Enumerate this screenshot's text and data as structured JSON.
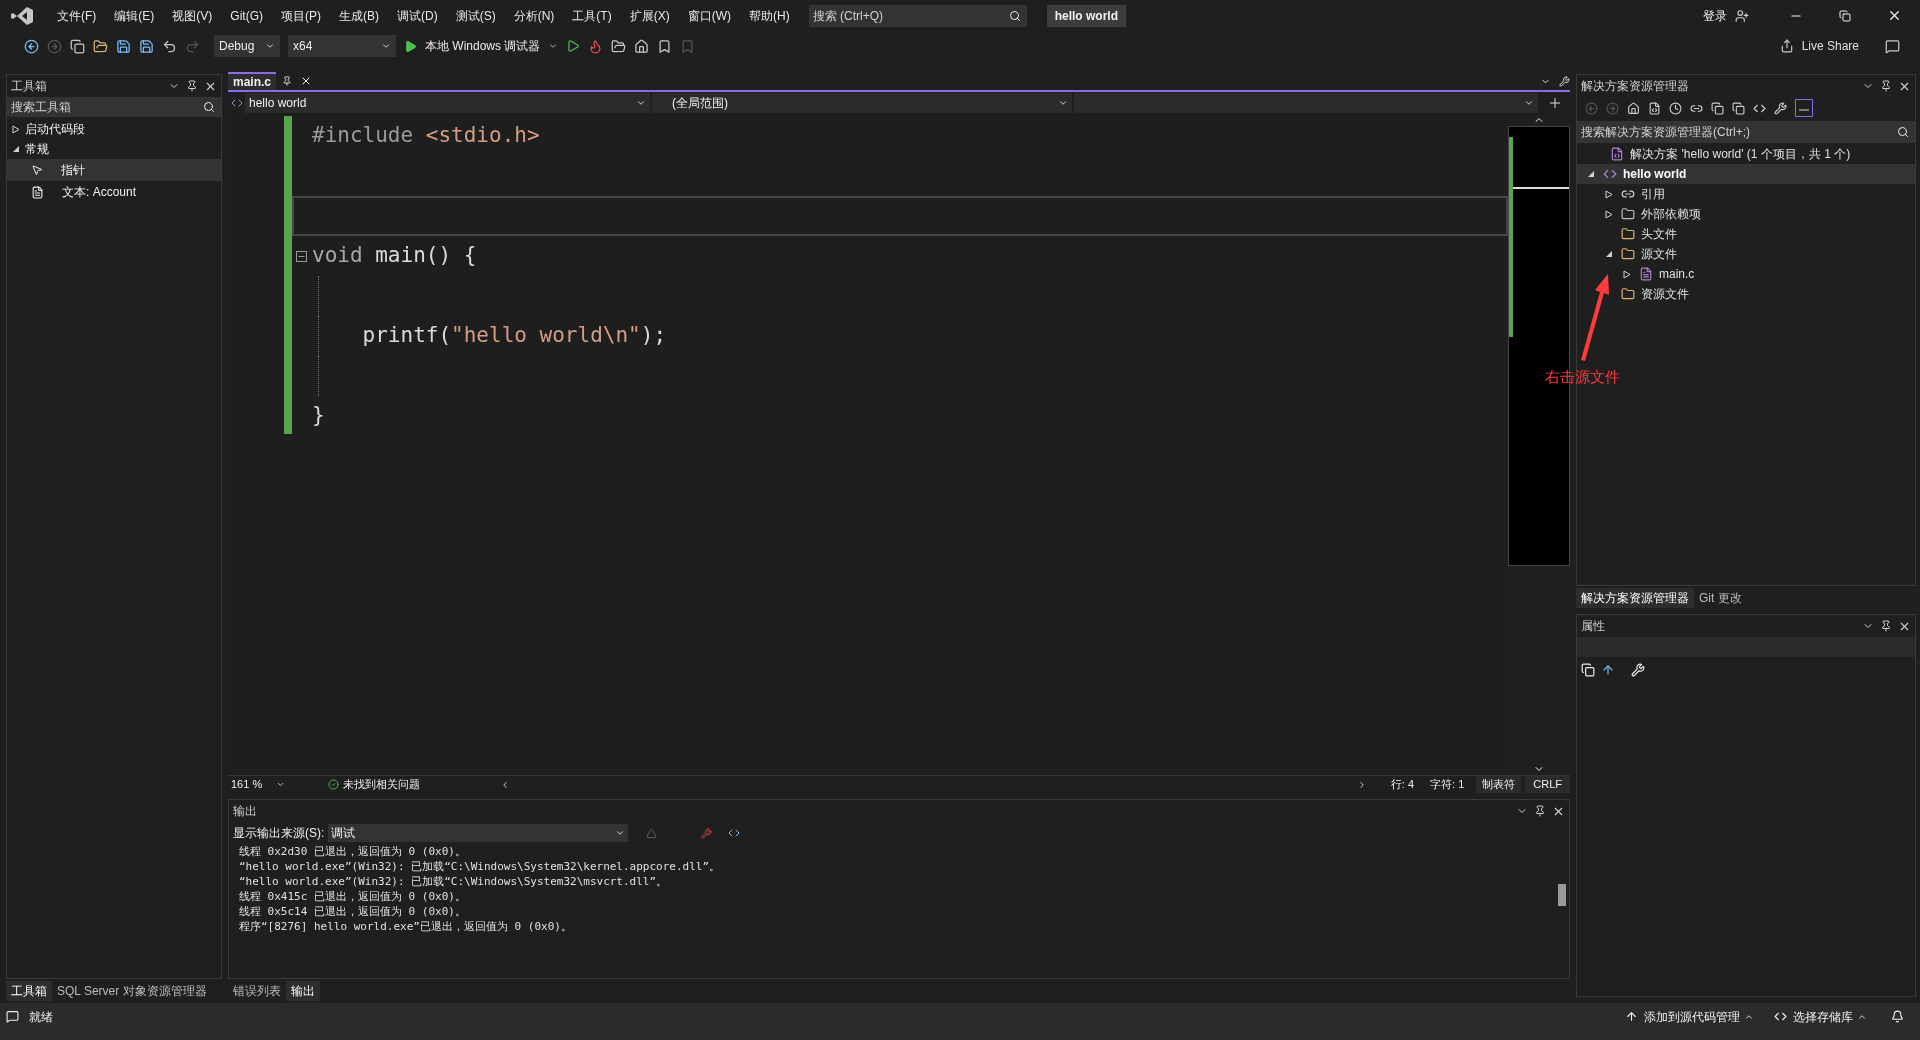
{
  "menu": [
    "文件(F)",
    "编辑(E)",
    "视图(V)",
    "Git(G)",
    "项目(P)",
    "生成(B)",
    "调试(D)",
    "测试(S)",
    "分析(N)",
    "工具(T)",
    "扩展(X)",
    "窗口(W)",
    "帮助(H)"
  ],
  "search": {
    "placeholder": "搜索 (Ctrl+Q)"
  },
  "solution_badge": "hello world",
  "account": "登录",
  "toolbar": {
    "configuration": "Debug",
    "platform": "x64",
    "run": "本地 Windows 调试器"
  },
  "live_share": "Live Share",
  "toolbox": {
    "title": "工具箱",
    "search_placeholder": "搜索工具箱",
    "groups": [
      {
        "label": "启动代码段",
        "expanded": false
      },
      {
        "label": "常规",
        "expanded": true,
        "children": [
          {
            "label": "指针",
            "kind": "pointer",
            "selected": true
          },
          {
            "label": "文本: Account",
            "kind": "text",
            "selected": false
          }
        ]
      }
    ]
  },
  "left_tabs": [
    {
      "label": "工具箱",
      "selected": true
    },
    {
      "label": "SQL Server 对象资源管理器",
      "selected": false
    }
  ],
  "editor": {
    "tabs": [
      {
        "label": "main.c",
        "selected": true
      }
    ],
    "nav": [
      "hello world",
      "(全局范围)"
    ],
    "lines": [
      {
        "current": false,
        "tokens": [
          {
            "text": "#include ",
            "kind": "preproc"
          },
          {
            "text": "<stdio.h>",
            "kind": "string"
          }
        ]
      },
      {
        "current": true
      },
      {
        "current": false,
        "fold": true,
        "tokens": [
          {
            "text": "void ",
            "kind": "keyword"
          },
          {
            "text": "main() {",
            "kind": "plain"
          }
        ]
      },
      {
        "current": false,
        "guide": true
      },
      {
        "current": false,
        "guide": true,
        "tokens": [
          {
            "text": "    printf(",
            "kind": "plain"
          },
          {
            "text": "\"hello world\\n\"",
            "kind": "string"
          },
          {
            "text": ");",
            "kind": "plain"
          }
        ]
      },
      {
        "current": false,
        "guide": true
      },
      {
        "current": false,
        "tokens": [
          {
            "text": "}",
            "kind": "plain"
          }
        ]
      }
    ],
    "zoom": "161 %",
    "issues": "未找到相关问题",
    "line": "行: 4",
    "column": "字符: 1",
    "indent": "制表符",
    "eol": "CRLF"
  },
  "output": {
    "title": "输出",
    "source_label": "显示输出来源(S):",
    "source": "调试",
    "lines": [
      "线程 0x2d30 已退出，返回值为 0 (0x0)。",
      "“hello world.exe”(Win32): 已加载“C:\\Windows\\System32\\kernel.appcore.dll”。",
      "“hello world.exe”(Win32): 已加载“C:\\Windows\\System32\\msvcrt.dll”。",
      "线程 0x415c 已退出，返回值为 0 (0x0)。",
      "线程 0x5c14 已退出，返回值为 0 (0x0)。",
      "程序“[8276] hello world.exe”已退出，返回值为 0 (0x0)。"
    ]
  },
  "bottom_tabs": [
    {
      "label": "错误列表",
      "selected": false
    },
    {
      "label": "输出",
      "selected": true
    }
  ],
  "solution_explorer": {
    "title": "解决方案资源管理器",
    "search_placeholder": "搜索解决方案资源管理器(Ctrl+;)",
    "tree": [
      {
        "label": "解决方案 'hello world' (1 个项目，共 1 个)",
        "kind": "solution",
        "selected": false
      },
      {
        "label": "hello world",
        "kind": "project",
        "expanded": true,
        "selected": true,
        "children": [
          {
            "label": "引用",
            "kind": "references",
            "expanded": false,
            "selected": false
          },
          {
            "label": "外部依赖项",
            "kind": "dependencies",
            "expanded": false,
            "selected": false
          },
          {
            "label": "头文件",
            "kind": "filter",
            "selected": false
          },
          {
            "label": "源文件",
            "kind": "filter",
            "expanded": true,
            "selected": false,
            "children": [
              {
                "label": "main.c",
                "kind": "cfile",
                "expanded": false,
                "selected": false
              }
            ]
          },
          {
            "label": "资源文件",
            "kind": "filter",
            "selected": false
          }
        ]
      }
    ]
  },
  "right_tabs": [
    {
      "label": "解决方案资源管理器",
      "selected": true
    },
    {
      "label": "Git 更改",
      "selected": false
    }
  ],
  "properties": {
    "title": "属性"
  },
  "annotation": {
    "text": "右击源文件"
  },
  "status": {
    "text": "就绪",
    "source_control": "添加到源代码管理",
    "repository": "选择存储库"
  }
}
